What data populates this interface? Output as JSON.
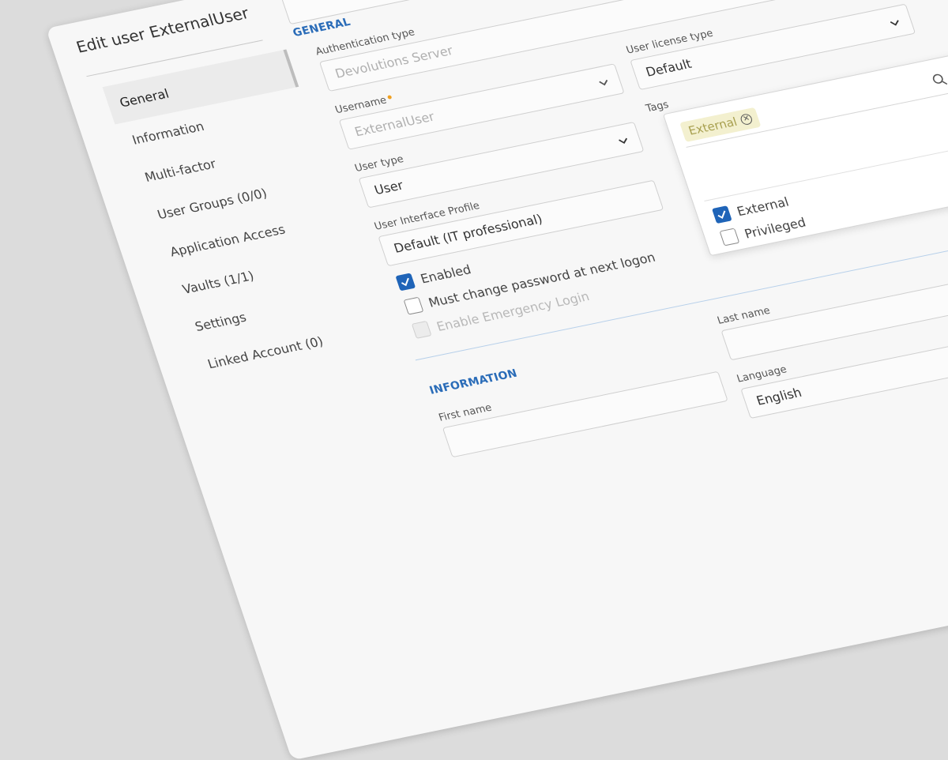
{
  "dialog": {
    "title": "Edit user ExternalUser"
  },
  "sidebar": {
    "items": [
      {
        "label": "General",
        "active": true
      },
      {
        "label": "Information"
      },
      {
        "label": "Multi-factor"
      },
      {
        "label": "User Groups (0/0)"
      },
      {
        "label": "Application Access"
      },
      {
        "label": "Vaults (1/1)"
      },
      {
        "label": "Settings"
      },
      {
        "label": "Linked Account (0)"
      }
    ]
  },
  "general": {
    "section_title": "GENERAL",
    "auth_type": {
      "label": "Authentication type",
      "value": "Devolutions Server"
    },
    "username": {
      "label": "Username",
      "value": "ExternalUser"
    },
    "license": {
      "label": "User license type",
      "value": "Default"
    },
    "user_type": {
      "label": "User type",
      "value": "User"
    },
    "tags": {
      "label": "Tags",
      "chip": "External"
    },
    "ui_profile": {
      "label": "User Interface Profile",
      "value": "Default (IT professional)"
    },
    "enabled": {
      "label": "Enabled",
      "checked": true
    },
    "must_change": {
      "label": "Must change password at next logon",
      "checked": false
    },
    "emergency": {
      "label": "Enable Emergency Login",
      "checked": false,
      "disabled": true
    }
  },
  "tag_dropdown": {
    "options": [
      {
        "label": "External",
        "checked": true
      },
      {
        "label": "Privileged",
        "checked": false
      }
    ]
  },
  "information": {
    "section_title": "INFORMATION",
    "first_name": {
      "label": "First name",
      "value": ""
    },
    "last_name": {
      "label": "Last name",
      "value": ""
    },
    "language": {
      "label": "Language",
      "value": "English"
    }
  },
  "colors": {
    "accent": "#1f64b8",
    "section": "#2a6cb8",
    "tag_bg": "#f3f0cf",
    "required": "#f0a020"
  }
}
